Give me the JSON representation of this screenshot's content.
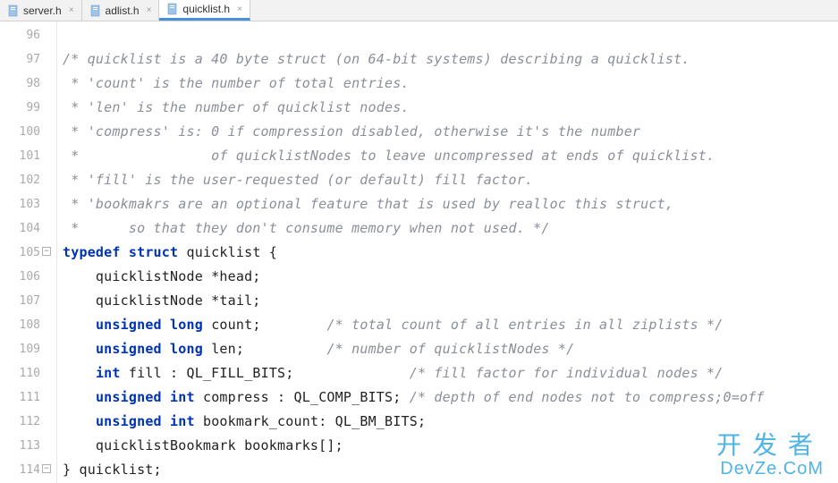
{
  "tabs": [
    {
      "label": "server.h",
      "active": false
    },
    {
      "label": "adlist.h",
      "active": false
    },
    {
      "label": "quicklist.h",
      "active": true
    }
  ],
  "gutter": {
    "start": 96,
    "end": 114
  },
  "code": {
    "line96": "",
    "line97": "/* quicklist is a 40 byte struct (on 64-bit systems) describing a quicklist.",
    "line98": " * 'count' is the number of total entries.",
    "line99": " * 'len' is the number of quicklist nodes.",
    "line100": " * 'compress' is: 0 if compression disabled, otherwise it's the number",
    "line101": " *                of quicklistNodes to leave uncompressed at ends of quicklist.",
    "line102": " * 'fill' is the user-requested (or default) fill factor.",
    "line103": " * 'bookmakrs are an optional feature that is used by realloc this struct,",
    "line104": " *      so that they don't consume memory when not used. */",
    "line105_kw1": "typedef",
    "line105_kw2": "struct",
    "line105_rest": " quicklist {",
    "line106": "    quicklistNode *head;",
    "line107": "    quicklistNode *tail;",
    "line108_kw1": "unsigned",
    "line108_kw2": "long",
    "line108_rest": " count;        ",
    "line108_comment": "/* total count of all entries in all ziplists */",
    "line109_kw1": "unsigned",
    "line109_kw2": "long",
    "line109_rest": " len;          ",
    "line109_comment": "/* number of quicklistNodes */",
    "line110_kw1": "int",
    "line110_rest": " fill : QL_FILL_BITS;              ",
    "line110_comment": "/* fill factor for individual nodes */",
    "line111_kw1": "unsigned",
    "line111_kw2": "int",
    "line111_rest": " compress : QL_COMP_BITS; ",
    "line111_comment": "/* depth of end nodes not to compress;0=off",
    "line112_kw1": "unsigned",
    "line112_kw2": "int",
    "line112_rest": " bookmark_count: QL_BM_BITS;",
    "line113": "    quicklistBookmark bookmarks[];",
    "line114": "} quicklist;"
  },
  "watermark": {
    "cn": "开发者",
    "en": "DevZe.CoM"
  }
}
